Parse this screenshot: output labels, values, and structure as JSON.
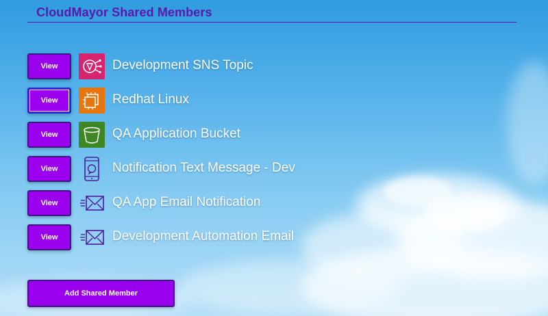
{
  "page": {
    "title": "CloudMayor Shared Members"
  },
  "members": [
    {
      "button_label": "View",
      "name": "Development SNS Topic",
      "icon": "sns-topic-icon",
      "icon_color": "#d6246e"
    },
    {
      "button_label": "View",
      "name": "Redhat Linux",
      "icon": "ec2-instance-icon",
      "icon_color": "#e8760f"
    },
    {
      "button_label": "View",
      "name": "QA Application Bucket",
      "icon": "s3-bucket-icon",
      "icon_color": "#3f8624"
    },
    {
      "button_label": "View",
      "name": "Notification Text Message - Dev",
      "icon": "mobile-phone-icon",
      "icon_color": "#4b1a9a"
    },
    {
      "button_label": "View",
      "name": "QA App Email Notification",
      "icon": "email-icon",
      "icon_color": "#4b1a9a"
    },
    {
      "button_label": "View",
      "name": "Development Automation Email",
      "icon": "email-icon",
      "icon_color": "#4b1a9a"
    }
  ],
  "actions": {
    "add_label": "Add Shared Member"
  },
  "colors": {
    "button": "#9b00ee",
    "button_border": "#3d1580",
    "title": "#5a1aa8",
    "focus_ring": "#1a2cd6"
  }
}
